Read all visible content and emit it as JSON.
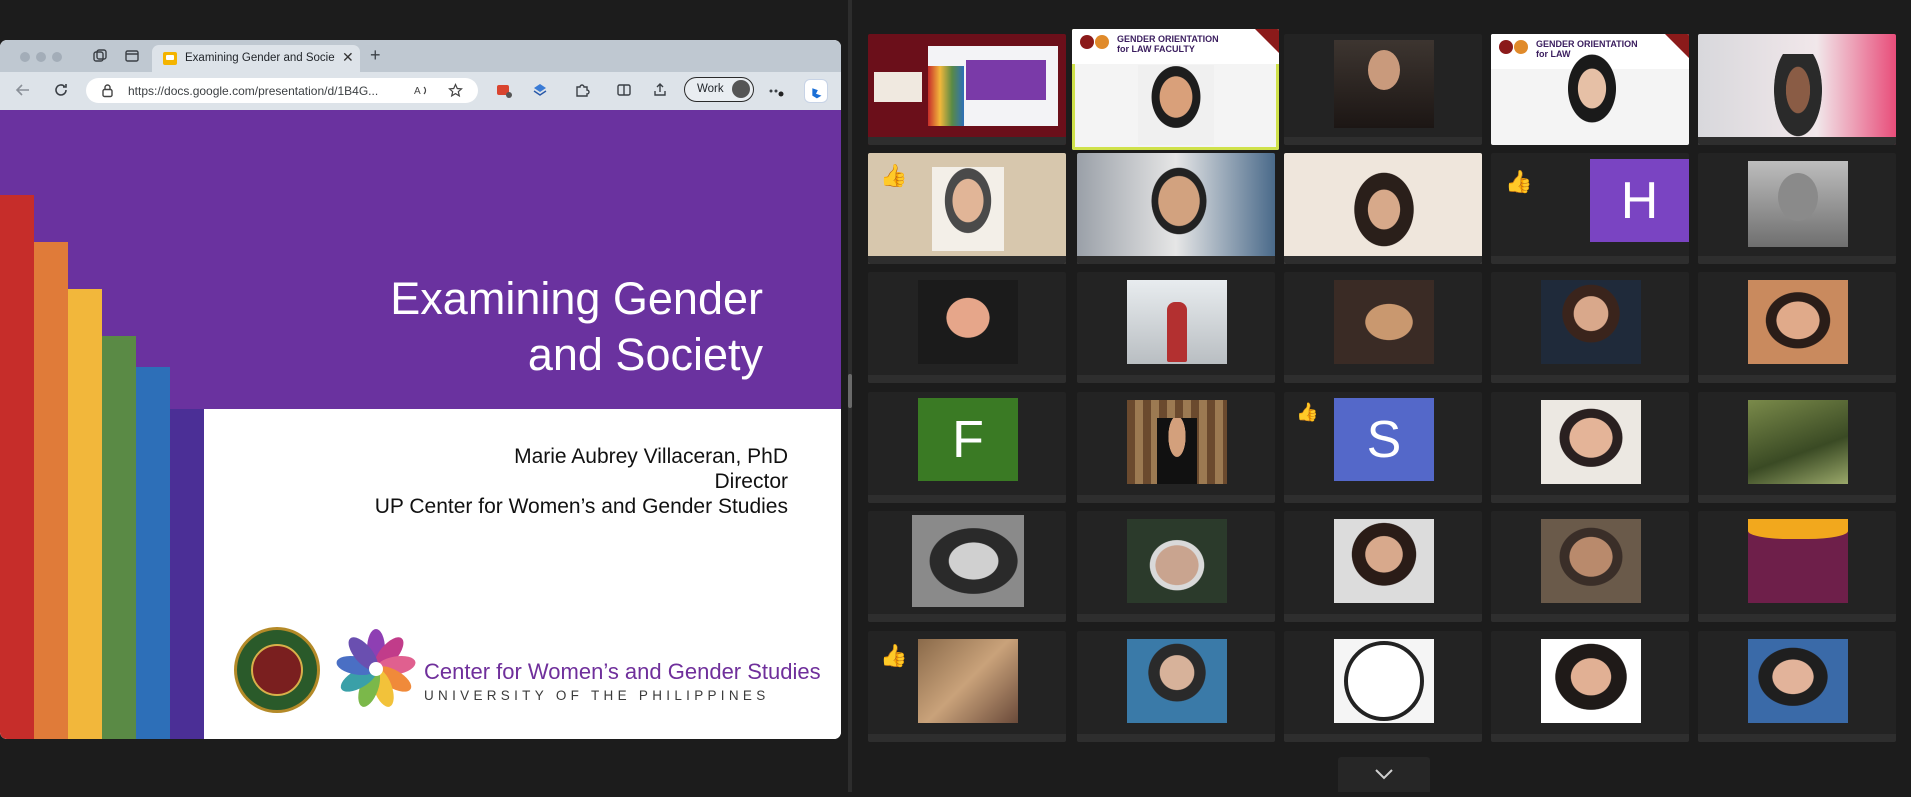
{
  "browser": {
    "tab_title": "Examining Gender and Society",
    "url": "https://docs.google.com/presentation/d/1B4G...",
    "profile_label": "Work"
  },
  "slide": {
    "title_line1": "Examining Gender",
    "title_line2": "and Society",
    "presenter_name": "Marie Aubrey Villaceran, PhD",
    "presenter_role": "Director",
    "presenter_org": "UP Center for Women’s and Gender Studies",
    "center_name": "Center for Women’s and Gender Studies",
    "university": "UNIVERSITY OF THE PHILIPPINES",
    "colors": {
      "purple": "#6a329f",
      "stripes": [
        "#c62d2a",
        "#e07b39",
        "#f2b73b",
        "#5a8a45",
        "#2d6fb8",
        "#4b2f96"
      ]
    }
  },
  "gallery": {
    "banner_title_line1": "GENDER ORIENTATION",
    "banner_title_line2": "for LAW FACULTY",
    "banner_title_short": "for LAW",
    "initials": {
      "h": "H",
      "f": "F",
      "s": "S"
    },
    "colors": {
      "h": "#7a44c2",
      "f": "#3a7a24",
      "s": "#5468c9",
      "active_border": "#cfe14a"
    }
  }
}
